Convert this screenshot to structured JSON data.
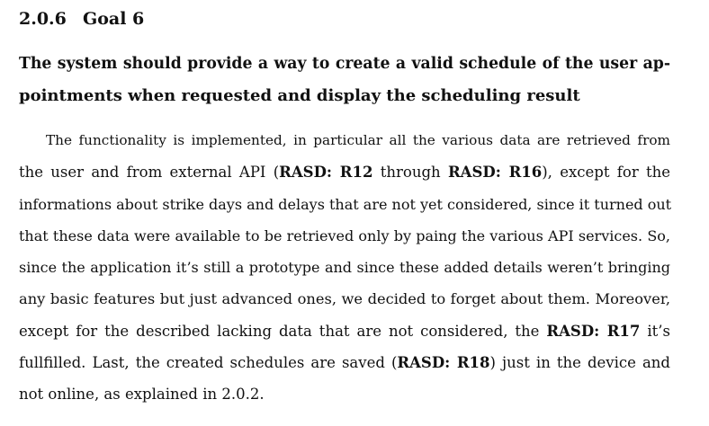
{
  "section": {
    "number": "2.0.6",
    "title": "Goal 6"
  },
  "goal_statement": {
    "line1": "The system should provide a way to create a valid schedule of the user ap-",
    "line2": "pointments when requested and display the scheduling result"
  },
  "body": {
    "l1": "The functionality is implemented, in particular all the various data are retrieved from",
    "l2_a": "the user and from external API (",
    "ref_r12": "RASD: R12",
    "l2_b": " through ",
    "ref_r16": "RASD: R16",
    "l2_c": "), except for the",
    "l3": "informations about strike days and delays that are not yet considered, since it turned out",
    "l4": "that these data were available to be retrieved only by paing the various API services. So,",
    "l5": "since the application it’s still a prototype and since these added details weren’t bringing",
    "l6": "any basic features but just advanced ones, we decided to forget about them. Moreover,",
    "l7_a": "except for the described lacking data that are not considered, the ",
    "ref_r17": "RASD: R17",
    "l7_b": " it’s",
    "l8_a": "fullfilled. Last, the created schedules are saved (",
    "ref_r18": "RASD: R18",
    "l8_b": ") just in the device and",
    "l9": "not online, as explained in 2.0.2."
  }
}
